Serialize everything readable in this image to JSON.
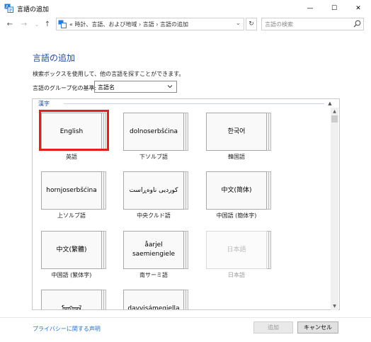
{
  "window": {
    "title": "言語の追加",
    "minimize_glyph": "—",
    "maximize_glyph": "☐",
    "close_glyph": "✕"
  },
  "nav": {
    "back_glyph": "←",
    "forward_glyph": "→",
    "recent_glyph": "⌄",
    "up_glyph": "↑",
    "address": "«  時計、言語、および地域  ›  言語  ›  言語の追加",
    "address_dropdown_glyph": "⌄",
    "refresh_glyph": "↻",
    "search_placeholder": "言語の検索"
  },
  "page": {
    "title": "言語の追加",
    "instructions": "検索ボックスを使用して、他の言語を探すことができます。",
    "group_label": "言語のグループ化の基準:",
    "group_value": "言語名"
  },
  "section": {
    "label": "漢字",
    "collapse_glyph": "▲"
  },
  "scrollbar": {
    "up_glyph": "▲",
    "down_glyph": "▼"
  },
  "languages": [
    {
      "native": "English",
      "caption": "英語",
      "enabled": true,
      "selected": true
    },
    {
      "native": "dolnoserbšćina",
      "caption": "下ソルブ語",
      "enabled": true,
      "selected": false
    },
    {
      "native": "한국어",
      "caption": "韓国語",
      "enabled": true,
      "selected": false
    },
    {
      "native": "hornjoserbšćina",
      "caption": "上ソルブ語",
      "enabled": true,
      "selected": false
    },
    {
      "native": "کوردیی ناوەڕاست",
      "caption": "中央クルド語",
      "enabled": true,
      "selected": false
    },
    {
      "native": "中文(简体)",
      "caption": "中国語 (簡体字)",
      "enabled": true,
      "selected": false
    },
    {
      "native": "中文(繁體)",
      "caption": "中国語 (繁体字)",
      "enabled": true,
      "selected": false
    },
    {
      "native": "åarjel\nsaemiengiele",
      "caption": "南サーミ語",
      "enabled": true,
      "selected": false
    },
    {
      "native": "日本語",
      "caption": "日本語",
      "enabled": false,
      "selected": false
    },
    {
      "native": "ᠮᠣᠩᠭᠣᠯ",
      "caption": "",
      "enabled": true,
      "selected": false
    },
    {
      "native": "davvisámegiella",
      "caption": "",
      "enabled": true,
      "selected": false
    }
  ],
  "footer": {
    "privacy_link": "プライバシーに関する声明",
    "add_button": "追加",
    "cancel_button": "キャンセル"
  },
  "colors": {
    "accent": "#1f4e9e",
    "selection_border": "#e31f1f",
    "link": "#1f6fd0"
  }
}
